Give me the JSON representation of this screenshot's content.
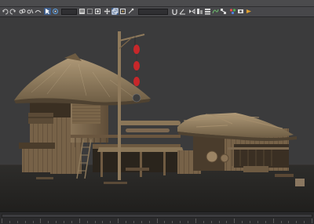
{
  "menu": {
    "items": [
      "",
      "",
      "",
      "",
      "",
      "",
      "",
      "",
      "",
      "",
      "",
      "",
      "",
      ""
    ]
  },
  "toolbar": {
    "selection_dropdown": "",
    "named_selection_dropdown": ""
  },
  "viewport": {
    "label": ""
  },
  "timeline": {
    "ticks": 40
  },
  "icons": {
    "undo": "undo-icon",
    "redo": "redo-icon",
    "link": "link-icon",
    "select": "select-object-icon",
    "move": "move-icon",
    "rotate": "rotate-icon",
    "scale": "scale-icon",
    "snap": "snap-toggle-icon",
    "mirror": "mirror-icon",
    "align": "align-icon",
    "render": "render-icon"
  },
  "colors": {
    "ui_bg": "#47474a",
    "viewport_bg": "#3b3b3c",
    "ground": "#2b2a28",
    "thatch": "#9a8666",
    "wood": "#6e5a42",
    "lantern": "#c7272a"
  }
}
